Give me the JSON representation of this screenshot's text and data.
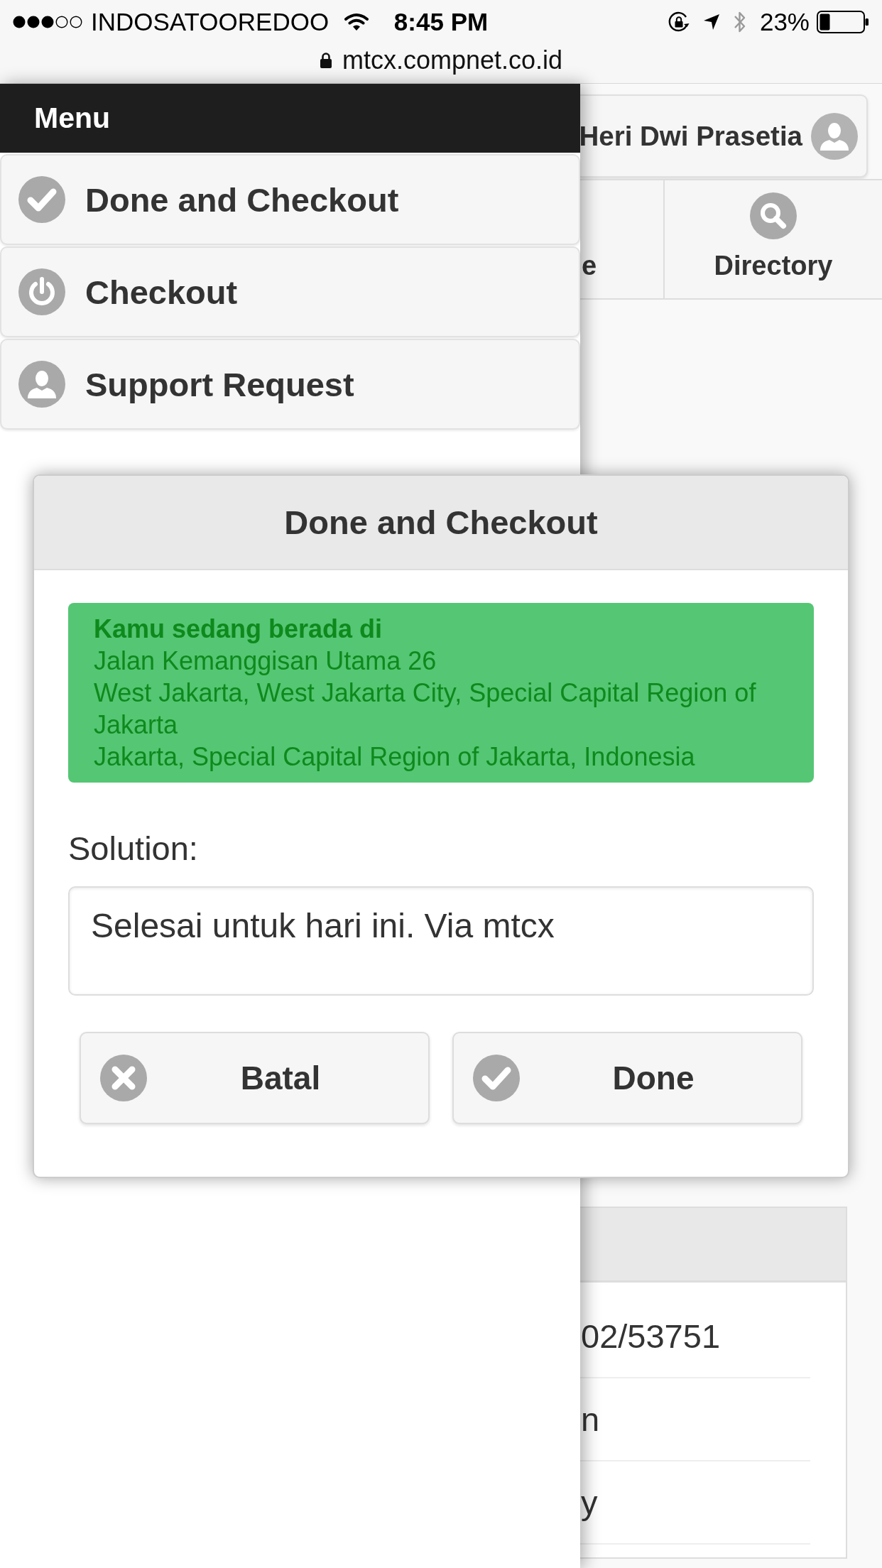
{
  "status_bar": {
    "carrier": "INDOSATOOREDOO",
    "time": "8:45 PM",
    "battery": "23%"
  },
  "browser": {
    "url": "mtcx.compnet.co.id"
  },
  "menu": {
    "title": "Menu",
    "items": [
      {
        "label": "Done and Checkout",
        "kind": "check"
      },
      {
        "label": "Checkout",
        "kind": "power"
      },
      {
        "label": "Support Request",
        "kind": "person"
      }
    ]
  },
  "page": {
    "user": "Heri Dwi Prasetia",
    "nav": [
      {
        "label": "e",
        "kind": "plain"
      },
      {
        "label": "Directory",
        "kind": "search"
      }
    ],
    "table": {
      "rows": [
        "02/53751",
        "n",
        "y"
      ]
    }
  },
  "dialog": {
    "title": "Done and Checkout",
    "alert": {
      "heading": "Kamu sedang berada di",
      "lines": [
        "Jalan Kemanggisan Utama 26",
        "West Jakarta, West Jakarta City, Special Capital Region of Jakarta",
        "Jakarta, Special Capital Region of Jakarta, Indonesia"
      ]
    },
    "solution": {
      "label": "Solution:",
      "value": "Selesai untuk hari ini. Via mtcx"
    },
    "buttons": [
      {
        "label": "Batal",
        "kind": "cancel"
      },
      {
        "label": "Done",
        "kind": "confirm"
      }
    ]
  }
}
